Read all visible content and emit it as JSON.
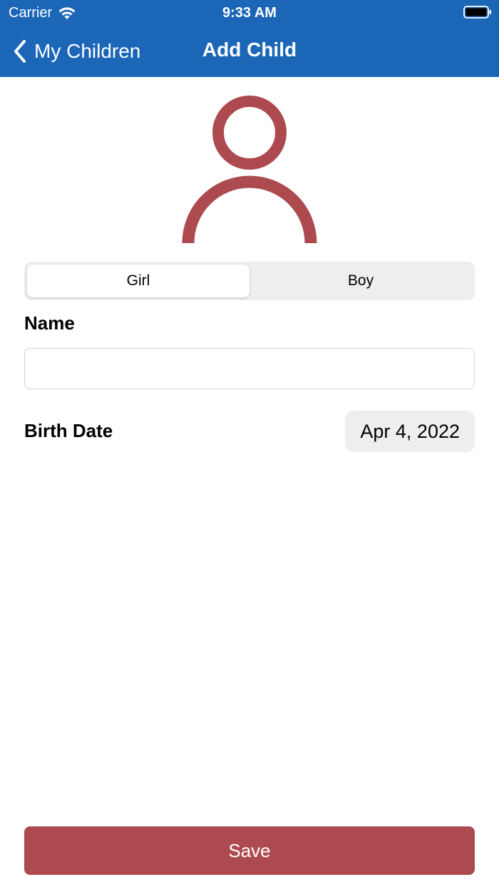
{
  "status_bar": {
    "carrier": "Carrier",
    "time": "9:33 AM"
  },
  "nav": {
    "back_label": "My Children",
    "title": "Add Child"
  },
  "avatar": {
    "icon": "person-icon",
    "color": "#ad4a4f"
  },
  "gender_segment": {
    "options": [
      "Girl",
      "Boy"
    ],
    "selected": "Girl"
  },
  "form": {
    "name_label": "Name",
    "name_value": "",
    "birth_label": "Birth Date",
    "birth_value": "Apr 4, 2022"
  },
  "actions": {
    "save_label": "Save"
  },
  "colors": {
    "header": "#1b66b7",
    "accent": "#ad4a4f",
    "control_bg": "#eeeeee"
  }
}
